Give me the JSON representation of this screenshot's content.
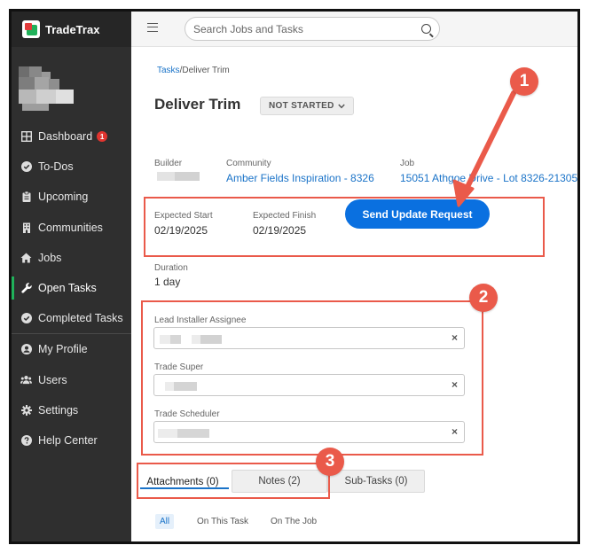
{
  "app": {
    "brand": "TradeTrax"
  },
  "sidebar": {
    "items": [
      {
        "label": "Dashboard",
        "icon": "dashboard-icon",
        "badge": "1"
      },
      {
        "label": "To-Dos",
        "icon": "check-circle-icon"
      },
      {
        "label": "Upcoming",
        "icon": "clipboard-icon"
      },
      {
        "label": "Communities",
        "icon": "building-icon"
      },
      {
        "label": "Jobs",
        "icon": "home-icon"
      },
      {
        "label": "Open Tasks",
        "icon": "wrench-icon",
        "active": true
      },
      {
        "label": "Completed Tasks",
        "icon": "check-circle-icon"
      },
      {
        "label": "My Profile",
        "icon": "user-circle-icon"
      },
      {
        "label": "Users",
        "icon": "users-icon"
      },
      {
        "label": "Settings",
        "icon": "gear-icon"
      },
      {
        "label": "Help Center",
        "icon": "question-circle-icon"
      }
    ]
  },
  "header": {
    "search_placeholder": "Search Jobs and Tasks"
  },
  "breadcrumb": {
    "root": "Tasks",
    "separator": "/",
    "current": "Deliver Trim"
  },
  "task": {
    "title": "Deliver Trim",
    "status": "NOT STARTED",
    "builder_label": "Builder",
    "community_label": "Community",
    "community_value": "Amber Fields Inspiration - 8326",
    "job_label": "Job",
    "job_value": "15051 Athgoe Drive - Lot 8326-21305",
    "expected_start_label": "Expected Start",
    "expected_start_value": "02/19/2025",
    "expected_finish_label": "Expected Finish",
    "expected_finish_value": "02/19/2025",
    "send_update_label": "Send Update Request",
    "duration_label": "Duration",
    "duration_value": "1 day",
    "lead_installer_label": "Lead Installer Assignee",
    "trade_super_label": "Trade Super",
    "trade_scheduler_label": "Trade Scheduler",
    "clear_symbol": "×"
  },
  "tabs": [
    {
      "label": "Attachments (0)",
      "active": true
    },
    {
      "label": "Notes (2)"
    },
    {
      "label": "Sub-Tasks (0)"
    }
  ],
  "filters": [
    {
      "label": "All",
      "selected": true
    },
    {
      "label": "On This Task"
    },
    {
      "label": "On The Job"
    }
  ],
  "annotations": {
    "one": "1",
    "two": "2",
    "three": "3",
    "color": "#ea5a4a"
  }
}
